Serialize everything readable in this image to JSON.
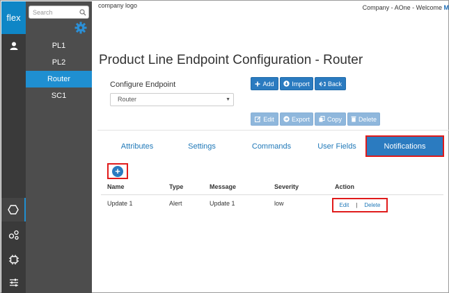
{
  "app": {
    "brand": "flex",
    "company_logo": "company logo",
    "welcome_prefix": "Company - AOne - Welcome",
    "welcome_user": "M"
  },
  "sidebar": {
    "search_placeholder": "Search",
    "items": [
      {
        "label": "PL1",
        "active": false
      },
      {
        "label": "PL2",
        "active": false
      },
      {
        "label": "Router",
        "active": true
      },
      {
        "label": "SC1",
        "active": false
      }
    ]
  },
  "page": {
    "title": "Product Line Endpoint Configuration - Router"
  },
  "endpoint": {
    "label": "Configure Endpoint",
    "selected": "Router"
  },
  "buttons": {
    "add": "Add",
    "import": "Import",
    "back": "Back",
    "edit": "Edit",
    "export": "Export",
    "copy": "Copy",
    "delete": "Delete"
  },
  "tabs": [
    {
      "label": "Attributes",
      "active": false
    },
    {
      "label": "Settings",
      "active": false
    },
    {
      "label": "Commands",
      "active": false
    },
    {
      "label": "User Fields",
      "active": false
    },
    {
      "label": "Notifications",
      "active": true
    }
  ],
  "table": {
    "columns": [
      "Name",
      "Type",
      "Message",
      "Severity",
      "Action"
    ],
    "rows": [
      {
        "name": "Update 1",
        "type": "Alert",
        "message": "Update 1",
        "severity": "low",
        "edit": "Edit",
        "delete": "Delete"
      }
    ]
  },
  "colors": {
    "accent": "#2b7bc0",
    "nav_active": "#1f8fd1",
    "highlight": "#e01b1b",
    "rail": "#3a3a3a",
    "nav": "#4d4d4d"
  }
}
